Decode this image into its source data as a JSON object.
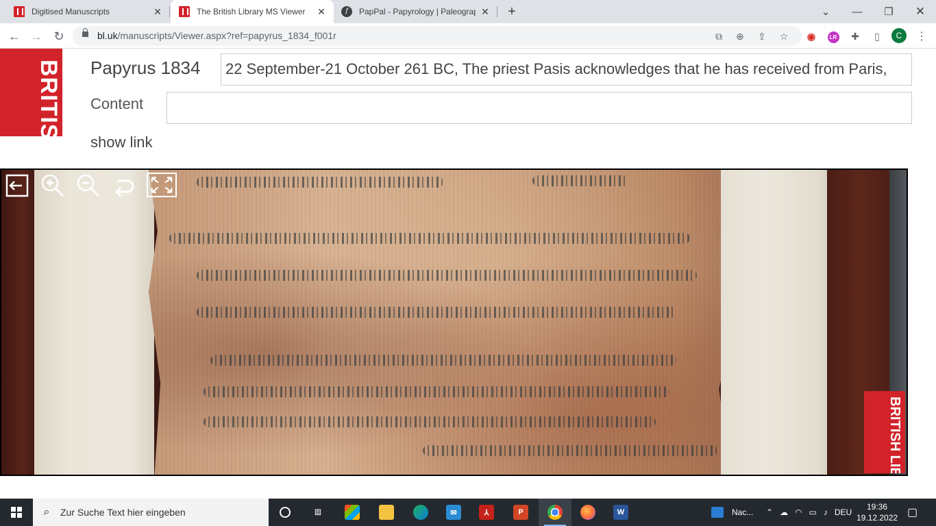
{
  "browser": {
    "tabs": [
      {
        "title": "Digitised Manuscripts",
        "favicon": "british-library-icon",
        "active": false
      },
      {
        "title": "The British Library MS Viewer",
        "favicon": "british-library-icon",
        "active": true
      },
      {
        "title": "PapPal - Papyrology | Paleograph",
        "favicon": "pappal-icon",
        "active": false
      }
    ],
    "url_host": "bl.uk",
    "url_path": "/manuscripts/Viewer.aspx?ref=papyrus_1834_f001r",
    "profile_initial": "C"
  },
  "page": {
    "logo_text": "BRITISH LIBRARY",
    "ms_title": "Papyrus 1834",
    "description": "22 September-21 October 261 BC, The priest Pasis acknowledges that he has received from Paris,",
    "content_label": "Content",
    "content_value": "",
    "show_link": "show link"
  },
  "viewer": {
    "tools": [
      "exit-icon",
      "zoom-in-icon",
      "zoom-out-icon",
      "rotate-icon",
      "fullscreen-icon"
    ],
    "badge_text": "BRITISH LIBRARY"
  },
  "taskbar": {
    "search_placeholder": "Zur Suche Text hier eingeben",
    "pinned": [
      "task-view",
      "microsoft-store",
      "file-explorer",
      "edge",
      "mail",
      "acrobat",
      "powerpoint",
      "chrome",
      "firefox",
      "word"
    ],
    "notification_label": "Nac...",
    "language": "DEU",
    "time": "19:36",
    "date": "19.12.2022"
  },
  "colors": {
    "bl_red": "#d2232a",
    "tab_strip": "#dee1e6",
    "taskbar": "#23292e"
  }
}
